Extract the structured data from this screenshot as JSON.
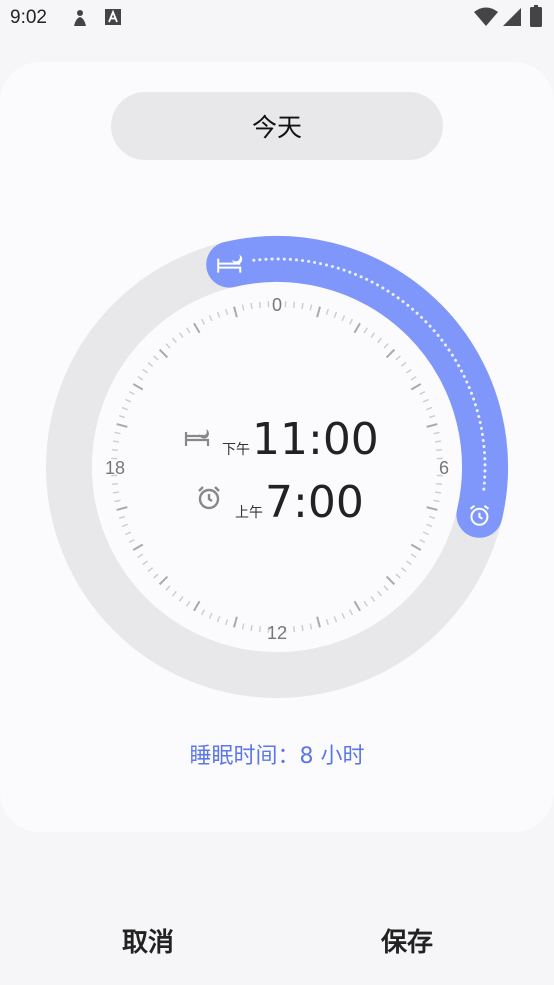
{
  "status_bar": {
    "time": "9:02"
  },
  "day_selector": {
    "label": "今天"
  },
  "dial": {
    "labels": [
      "0",
      "6",
      "12",
      "18"
    ],
    "bedtime_hour": 23,
    "wake_hour": 7,
    "accent_color": "#7f97fb",
    "track_color": "#e8e8ea"
  },
  "bedtime": {
    "ampm": "下午",
    "time": "11:00"
  },
  "wake": {
    "ampm": "上午",
    "time": "7:00"
  },
  "summary": "睡眠时间：8 小时",
  "actions": {
    "cancel": "取消",
    "save": "保存"
  }
}
